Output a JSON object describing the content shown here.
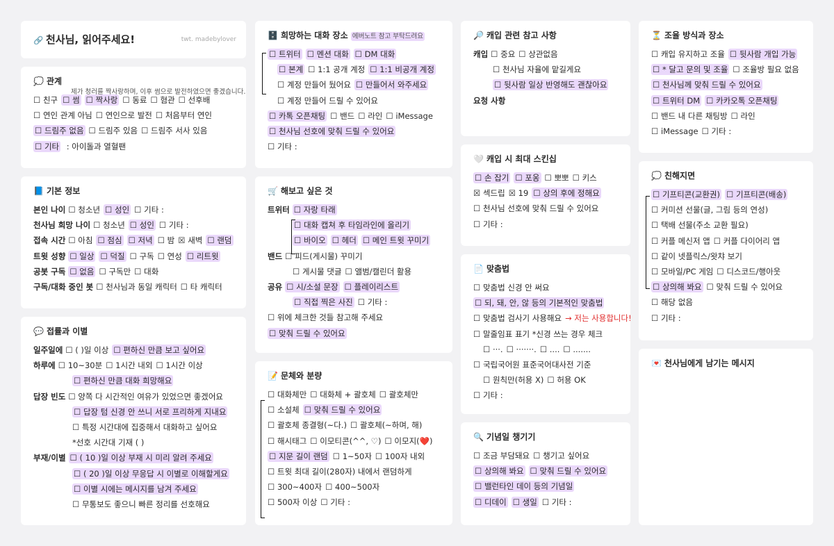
{
  "title_card": {
    "icon": "🔗",
    "title": "천사님, 읽어주세요!",
    "credit": "twt. madebylover"
  },
  "relationship": {
    "icon": "💭",
    "title": "관계",
    "note": "제가 청러를 짝사랑하며, 이후 썸으로 발전하였으면 좋겠습니다.",
    "lines": [
      [
        [
          "☐ 친구",
          false
        ],
        [
          "☐ 썸",
          true
        ],
        [
          "☐ 짝사랑",
          true
        ],
        [
          "☐ 동료",
          false
        ],
        [
          "☐ 혐관",
          false
        ],
        [
          "☐ 선후배",
          false
        ]
      ],
      [
        [
          "☐ 연인 관계 아님",
          false
        ],
        [
          "☐ 연인으로 발전",
          false
        ],
        [
          "☐ 처음부터 연인",
          false
        ]
      ],
      [
        [
          "☐ 드림주 없음",
          true
        ],
        [
          "☐ 드림주 있음",
          false
        ],
        [
          "☐ 드림주 서사 있음",
          false
        ]
      ],
      [
        [
          "☐ 기타",
          true
        ],
        [
          " : 아이돌과 열혈팬",
          false
        ]
      ]
    ]
  },
  "basic_info": {
    "icon": "📘",
    "title": "기본 정보",
    "rows": [
      {
        "label": "본인 나이",
        "items": [
          [
            "☐ 청소년",
            false
          ],
          [
            "☐ 성인",
            true
          ],
          [
            "☐ 기타 :",
            false
          ]
        ]
      },
      {
        "label": "천사님 희망 나이",
        "items": [
          [
            "☐ 청소년",
            false
          ],
          [
            "☐ 성인",
            true
          ],
          [
            "☐ 기타 :",
            false
          ]
        ]
      },
      {
        "label": "접속 시간",
        "items": [
          [
            "☐ 아침",
            false
          ],
          [
            "☐ 점심",
            true
          ],
          [
            "☐ 저녁",
            true
          ],
          [
            "☐ 밤",
            false
          ],
          [
            "☒ 새벽",
            false
          ],
          [
            "☐ 랜덤",
            true
          ]
        ]
      },
      {
        "label": "트윗 성향",
        "items": [
          [
            "☐ 일상",
            true
          ],
          [
            "☐ 덕질",
            true
          ],
          [
            "☐ 구독",
            false
          ],
          [
            "☐ 연성",
            false
          ],
          [
            "☐ 리트윗",
            true
          ]
        ]
      },
      {
        "label": "공봇 구독",
        "items": [
          [
            "☐ 없음",
            true
          ],
          [
            "☐ 구독만",
            false
          ],
          [
            "☐ 대화",
            false
          ]
        ]
      },
      {
        "label": "구독/대화 중인 봇",
        "items": [
          [
            "☐ 천사님과 동일 캐릭터",
            false
          ],
          [
            "☐ 타 캐릭터",
            false
          ]
        ]
      }
    ]
  },
  "contact": {
    "icon": "💬",
    "title": "접률과 이별",
    "lines": [
      {
        "label": "일주일에",
        "items": [
          [
            "☐ (        )일 이상",
            false
          ],
          [
            "☐ 편하신 만큼 보고 싶어요",
            true
          ]
        ]
      },
      {
        "label": "하루에",
        "items": [
          [
            "☐ 10~30분",
            false
          ],
          [
            "☐ 1시간 내외",
            false
          ],
          [
            "☐ 1시간 이상",
            false
          ]
        ]
      },
      {
        "label": "",
        "indent": true,
        "items": [
          [
            "☐ 편하신 만큼  대화 희망해요",
            true
          ]
        ]
      },
      {
        "label": "답장 빈도",
        "items": [
          [
            "☐ 양쪽 다 시간적인 여유가 있었으면 좋겠어요",
            false
          ]
        ]
      },
      {
        "label": "",
        "indent": true,
        "items": [
          [
            "☐ 답장 텀 신경 안 쓰니 서로 프리하게 지내요",
            true
          ]
        ]
      },
      {
        "label": "",
        "indent": true,
        "items": [
          [
            "☐ 특정 시간대에 집중해서 대화하고 싶어요",
            false
          ]
        ]
      },
      {
        "label": "",
        "indent": true,
        "items": [
          [
            "   *선호 시간대 기재 (                              )",
            false
          ]
        ]
      },
      {
        "label": "부재/이별",
        "items": [
          [
            "☐ ( 10 )일 이상 부재 시 미리 알려 주세요",
            true
          ]
        ]
      },
      {
        "label": "",
        "indent": true,
        "items": [
          [
            "☐ ( 20 )일 이상 무응답 시 이별로 이해할게요",
            true
          ]
        ]
      },
      {
        "label": "",
        "indent": true,
        "items": [
          [
            "☐ 이별 시에는 메시지를 남겨 주세요",
            true
          ]
        ]
      },
      {
        "label": "",
        "indent": true,
        "items": [
          [
            "☐ 무통보도 좋으니 빠른 정리를 선호해요",
            false
          ]
        ]
      }
    ]
  },
  "chat_place": {
    "icon": "🗄️",
    "title": "희망하는 대화 장소",
    "tag": "에버노트 참고 부탁드려요",
    "lines": [
      {
        "indent": 0,
        "items": [
          [
            "☐ 트위터",
            true
          ],
          [
            "☐ 멘션 대화",
            true
          ],
          [
            "☐ DM 대화",
            true
          ]
        ]
      },
      {
        "indent": 1,
        "items": [
          [
            "☐ 본계",
            true
          ],
          [
            "☐ 1:1 공개 계정",
            false
          ],
          [
            "☐ 1:1 비공개 계정",
            true
          ]
        ]
      },
      {
        "indent": 1,
        "items": [
          [
            "☐ 계정 만들어 뒀어요",
            false
          ],
          [
            "☐ 만들어서 와주세요",
            true
          ]
        ]
      },
      {
        "indent": 1,
        "items": [
          [
            "☐ 계정 만들어 드릴 수 있어요",
            false
          ]
        ]
      },
      {
        "indent": 0,
        "items": [
          [
            "☐ 카톡 오픈채팅",
            true
          ],
          [
            "☐ 밴드",
            false
          ],
          [
            "☐ 라인",
            false
          ],
          [
            "☐ iMessage",
            false
          ]
        ]
      },
      {
        "indent": 0,
        "items": [
          [
            "☐ 천사님 선호에 맞춰 드릴 수 있어요",
            true
          ]
        ]
      },
      {
        "indent": 0,
        "items": [
          [
            "☐ 기타 :",
            false
          ]
        ]
      }
    ]
  },
  "wish": {
    "icon": "🛒",
    "title": "해보고 싶은 것",
    "lines": [
      {
        "label": "트위터",
        "items": [
          [
            "☐ 자랑 타래",
            true
          ]
        ]
      },
      {
        "label": "",
        "indent": true,
        "items": [
          [
            "☐ 대화 캡쳐 후 타임라인에 올리기",
            true
          ]
        ]
      },
      {
        "label": "",
        "indent": true,
        "items": [
          [
            "☐ 바이오",
            true
          ],
          [
            "☐ 헤더",
            true
          ],
          [
            "☐ 메인 트윗 꾸미기",
            true
          ]
        ]
      },
      {
        "label": "밴드",
        "items": [
          [
            "☐ 피드(게시물) 꾸미기",
            false
          ]
        ]
      },
      {
        "label": "",
        "indent": true,
        "items": [
          [
            "☐ 게시물 댓글",
            false
          ],
          [
            "☐ 앨범/캘린더 활용",
            false
          ]
        ]
      },
      {
        "label": "공유",
        "items": [
          [
            "☐ 시/소설 문장",
            true
          ],
          [
            "☐ 플레이리스트",
            true
          ]
        ]
      },
      {
        "label": "",
        "indent": true,
        "items": [
          [
            "☐ 직접 찍은 사진",
            true
          ],
          [
            "☐ 기타 :",
            false
          ]
        ]
      },
      {
        "label": "",
        "items": [
          [
            "☐ 위에 체크한 것들 참고해 주세요",
            false
          ]
        ]
      },
      {
        "label": "",
        "items": [
          [
            "☐ 맞춰 드릴 수 있어요",
            true
          ]
        ]
      }
    ]
  },
  "style": {
    "icon": "📝",
    "title": "문체와 분량",
    "lines": [
      [
        [
          "☐ 대화체만",
          false
        ],
        [
          "☐ 대화체 + 괄호체",
          false
        ],
        [
          "☐ 괄호체만",
          false
        ]
      ],
      [
        [
          "☐ 소설체",
          false
        ],
        [
          "☐ 맞춰 드릴 수 있어요",
          true
        ]
      ],
      [
        [
          "☐ 괄호체 종결형(~다.)",
          false
        ],
        [
          "☐ 괄호체(~하며, 해)",
          false
        ]
      ],
      [
        [
          "☐ 해시태그",
          false
        ],
        [
          "☐ 이모티콘(^^, ♡)",
          false
        ],
        [
          "☐ 이모지(❤️)",
          false
        ]
      ],
      [
        [
          "☐ 지문 길이 랜덤",
          true
        ],
        [
          "☐ 1~50자",
          false
        ],
        [
          "☐ 100자 내외",
          false
        ]
      ],
      [
        [
          "☐ 트윗 최대 길이(280자) 내에서 랜덤하게",
          false
        ]
      ],
      [
        [
          "☐ 300~400자",
          false
        ],
        [
          "☐ 400~500자",
          false
        ]
      ],
      [
        [
          "☐ 500자 이상",
          false
        ],
        [
          "☐ 기타 :",
          false
        ]
      ]
    ]
  },
  "cap": {
    "icon": "🔎",
    "title": "캐입 관련 참고 사항",
    "lines": [
      {
        "label": "캐입",
        "indent": 0,
        "items": [
          [
            "☐ 중요",
            false
          ],
          [
            "☐ 상관없음",
            false
          ]
        ]
      },
      {
        "label": "",
        "indent": 2,
        "items": [
          [
            "☐ 천사님 자율에 맡길게요",
            false
          ]
        ]
      },
      {
        "label": "",
        "indent": 2,
        "items": [
          [
            "☐ 뒷사람 일상 반영해도 괜찮아요",
            true
          ]
        ]
      },
      {
        "label": "요청 사항",
        "indent": 0,
        "items": []
      }
    ]
  },
  "skinship": {
    "icon": "🤍",
    "title": "캐입 시 최대 스킨십",
    "lines": [
      [
        [
          "☐ 손 잡기",
          true
        ],
        [
          "☐ 포옹",
          true
        ],
        [
          "☐ 뽀뽀",
          false
        ],
        [
          "☐ 키스",
          false
        ]
      ],
      [
        [
          "☒ 섹드립",
          false
        ],
        [
          "☒ 19",
          false
        ],
        [
          "☐ 상의 후에 정해요",
          true
        ]
      ],
      [
        [
          "☐ 천사님 선호에 맞춰 드릴 수 있어요",
          false
        ]
      ],
      [
        [
          "☐ 기타 :",
          false
        ]
      ]
    ]
  },
  "spelling": {
    "icon": "📄",
    "title": "맞춤법",
    "lines": [
      {
        "indent": 0,
        "items": [
          [
            "☐ 맞춤법 신경 안 써요",
            false
          ]
        ]
      },
      {
        "indent": 0,
        "items": [
          [
            "☐ 되, 돼, 안, 않 등의 기본적인 맞춤법",
            true
          ]
        ]
      },
      {
        "indent": 0,
        "items": [
          [
            "☐ 맞춤법 검사기 사용해요",
            false
          ],
          [
            "→ 저는 사용합니다!",
            "red"
          ]
        ]
      },
      {
        "indent": 0,
        "items": [
          [
            "☐ 말줄임표 표기 *신경 쓰는 경우 체크",
            false
          ]
        ]
      },
      {
        "indent": 1,
        "items": [
          [
            "☐ ···.",
            false
          ],
          [
            "☐ ·······.",
            false
          ],
          [
            "☐ ....",
            false
          ],
          [
            "☐ .......",
            false
          ]
        ]
      },
      {
        "indent": 0,
        "items": [
          [
            "☐ 국립국어원 표준국어대사전 기준",
            false
          ]
        ]
      },
      {
        "indent": 1,
        "items": [
          [
            "☐ 원칙만(허용 X)",
            false
          ],
          [
            "☐ 허용 OK",
            false
          ]
        ]
      },
      {
        "indent": 0,
        "items": [
          [
            "☐ 기타 :",
            false
          ]
        ]
      }
    ]
  },
  "anniversary": {
    "icon": "🔍",
    "title": "기념일 챙기기",
    "lines": [
      [
        [
          "☐ 조금 부담돼요",
          false
        ],
        [
          "☐ 챙기고 싶어요",
          false
        ]
      ],
      [
        [
          "☐ 상의해 봐요",
          true
        ],
        [
          "☐ 맞춰 드릴 수 있어요",
          true
        ]
      ],
      [
        [
          "☐ 밸런타인 데이 등의 기념일",
          true
        ]
      ],
      [
        [
          "☐ 디데이",
          true
        ],
        [
          "☐ 생일",
          true
        ],
        [
          "☐ 기타 :",
          false
        ]
      ]
    ]
  },
  "adjust": {
    "icon": "⏳",
    "title": "조율 방식과 장소",
    "lines": [
      [
        [
          "☐ 캐입 유지하고 조율",
          false
        ],
        [
          "☐ 뒷사람 개입 가능",
          true
        ]
      ],
      [
        [
          "☐ * 달고 문의 및 조율",
          true
        ],
        [
          "☐ 조율방 필요 없음",
          false
        ]
      ],
      [
        [
          "☐ 천사님께 맞춰 드릴 수 있어요",
          true
        ]
      ],
      [
        [
          "☐ 트위터 DM",
          true
        ],
        [
          "☐ 카카오톡 오픈채팅",
          true
        ]
      ],
      [
        [
          "☐ 밴드 내 다른 채팅방",
          false
        ],
        [
          "☐ 라인",
          false
        ]
      ],
      [
        [
          "☐ iMessage",
          false
        ],
        [
          "☐ 기타 :",
          false
        ]
      ]
    ]
  },
  "close": {
    "icon": "💭",
    "title": "친해지면",
    "lines": [
      [
        [
          "☐ 기프티콘(교환권)",
          true
        ],
        [
          "☐ 기프티콘(배송)",
          true
        ]
      ],
      [
        [
          "☐ 커미션 선물(글, 그림 등의 연성)",
          false
        ]
      ],
      [
        [
          "☐ 택배 선물(주소 교환 필요)",
          false
        ]
      ],
      [
        [
          "☐ 커플 메신저 앱",
          false
        ],
        [
          "☐ 커플 다이어리 앱",
          false
        ]
      ],
      [
        [
          "☐ 같이 넷플릭스/왓챠 보기",
          false
        ]
      ],
      [
        [
          "☐ 모바일/PC 게임",
          false
        ],
        [
          "☐ 디스코드/행아웃",
          false
        ]
      ],
      [
        [
          "☐ 상의해 봐요",
          true
        ],
        [
          "☐ 맞춰 드릴 수 있어요",
          false
        ]
      ],
      [
        [
          "☐ 해당 없음",
          false
        ]
      ],
      [
        [
          "☐ 기타 :",
          false
        ]
      ]
    ]
  },
  "message": {
    "icon": "💌",
    "title": "천사님에게 남기는 메시지"
  }
}
